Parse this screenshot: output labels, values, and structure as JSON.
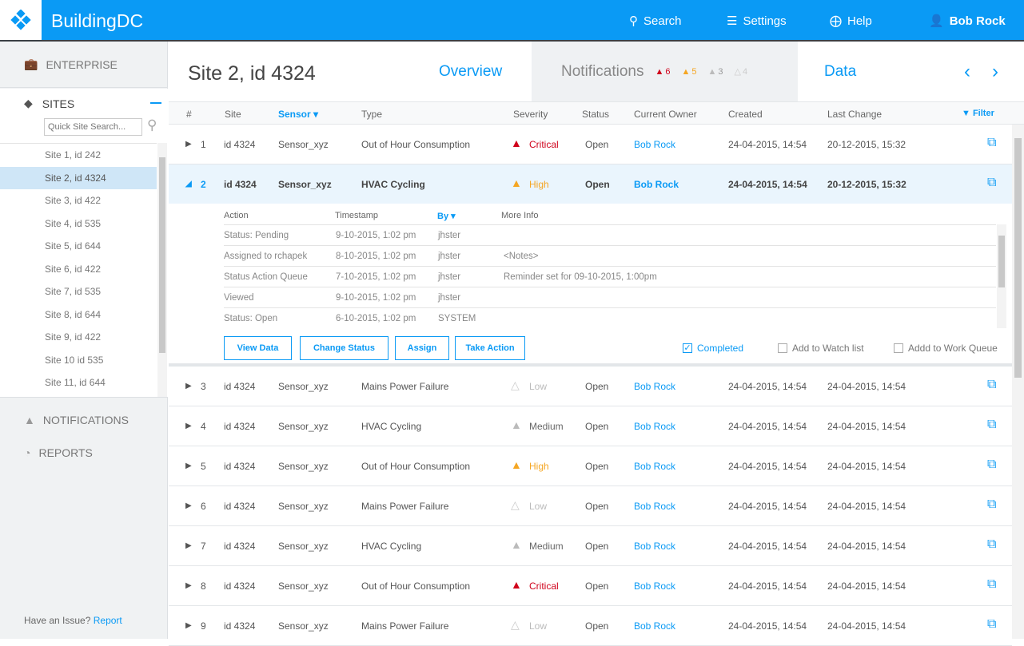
{
  "header": {
    "brand": "BuildingDC",
    "search": "Search",
    "settings": "Settings",
    "help": "Help",
    "user": "Bob Rock"
  },
  "sidebar": {
    "enterprise": "ENTERPRISE",
    "sites": "SITES",
    "search_placeholder": "Quick Site Search...",
    "items": [
      "Site 1, id 242",
      "Site 2, id 4324",
      "Site 3, id 422",
      "Site 4, id 535",
      "Site 5, id 644",
      "Site 6, id 422",
      "Site 7, id 535",
      "Site 8, id 644",
      "Site 9, id 422",
      "Site 10 id 535",
      "Site 11, id 644"
    ],
    "notifications": "NOTIFICATIONS",
    "reports": "REPORTS",
    "issue": "Have an Issue?",
    "report_link": "Report"
  },
  "page": {
    "title": "Site 2, id 4324",
    "tabs": {
      "overview": "Overview",
      "notifications": "Notifications",
      "data": "Data"
    },
    "badges": {
      "critical": "6",
      "high": "5",
      "medium": "3",
      "low": "4"
    }
  },
  "table": {
    "headers": {
      "num": "#",
      "site": "Site",
      "sensor": "Sensor",
      "type": "Type",
      "severity": "Severity",
      "status": "Status",
      "owner": "Current Owner",
      "created": "Created",
      "last": "Last Change",
      "filter": "Filter"
    },
    "rows": [
      {
        "n": "1",
        "site": "id 4324",
        "sensor": "Sensor_xyz",
        "type": "Out of Hour Consumption",
        "sev": "Critical",
        "status": "Open",
        "owner": "Bob Rock",
        "created": "24-04-2015, 14:54",
        "last": "20-12-2015, 15:32"
      },
      {
        "n": "2",
        "site": "id 4324",
        "sensor": "Sensor_xyz",
        "type": "HVAC Cycling",
        "sev": "High",
        "status": "Open",
        "owner": "Bob Rock",
        "created": "24-04-2015, 14:54",
        "last": "20-12-2015, 15:32"
      },
      {
        "n": "3",
        "site": "id 4324",
        "sensor": "Sensor_xyz",
        "type": "Mains Power Failure",
        "sev": "Low",
        "status": "Open",
        "owner": "Bob Rock",
        "created": "24-04-2015, 14:54",
        "last": "24-04-2015, 14:54"
      },
      {
        "n": "4",
        "site": "id 4324",
        "sensor": "Sensor_xyz",
        "type": "HVAC Cycling",
        "sev": "Medium",
        "status": "Open",
        "owner": "Bob Rock",
        "created": "24-04-2015, 14:54",
        "last": "24-04-2015, 14:54"
      },
      {
        "n": "5",
        "site": "id 4324",
        "sensor": "Sensor_xyz",
        "type": "Out of Hour Consumption",
        "sev": "High",
        "status": "Open",
        "owner": "Bob Rock",
        "created": "24-04-2015, 14:54",
        "last": "24-04-2015, 14:54"
      },
      {
        "n": "6",
        "site": "id 4324",
        "sensor": "Sensor_xyz",
        "type": "Mains Power Failure",
        "sev": "Low",
        "status": "Open",
        "owner": "Bob Rock",
        "created": "24-04-2015, 14:54",
        "last": "24-04-2015, 14:54"
      },
      {
        "n": "7",
        "site": "id 4324",
        "sensor": "Sensor_xyz",
        "type": "HVAC Cycling",
        "sev": "Medium",
        "status": "Open",
        "owner": "Bob Rock",
        "created": "24-04-2015, 14:54",
        "last": "24-04-2015, 14:54"
      },
      {
        "n": "8",
        "site": "id 4324",
        "sensor": "Sensor_xyz",
        "type": "Out of Hour Consumption",
        "sev": "Critical",
        "status": "Open",
        "owner": "Bob Rock",
        "created": "24-04-2015, 14:54",
        "last": "24-04-2015, 14:54"
      },
      {
        "n": "9",
        "site": "id 4324",
        "sensor": "Sensor_xyz",
        "type": "Mains Power Failure",
        "sev": "Low",
        "status": "Open",
        "owner": "Bob Rock",
        "created": "24-04-2015, 14:54",
        "last": "24-04-2015, 14:54"
      }
    ]
  },
  "detail": {
    "headers": {
      "action": "Action",
      "timestamp": "Timestamp",
      "by": "By",
      "info": "More Info"
    },
    "rows": [
      {
        "action": "Status: Pending",
        "ts": "9-10-2015, 1:02 pm",
        "by": "jhster",
        "info": ""
      },
      {
        "action": "Assigned to rchapek",
        "ts": "8-10-2015, 1:02 pm",
        "by": "jhster",
        "info": "<Notes>"
      },
      {
        "action": "Status Action Queue",
        "ts": "7-10-2015, 1:02 pm",
        "by": "jhster",
        "info": "Reminder set for 09-10-2015, 1:00pm"
      },
      {
        "action": "Viewed",
        "ts": "9-10-2015, 1:02 pm",
        "by": "jhster",
        "info": ""
      },
      {
        "action": "Status: Open",
        "ts": "6-10-2015, 1:02 pm",
        "by": "SYSTEM",
        "info": ""
      }
    ],
    "buttons": [
      "View Data",
      "Change Status",
      "Assign",
      "Take Action"
    ],
    "checks": {
      "completed": "Completed",
      "watch": "Add to Watch list",
      "queue": "Addd to Work Queue"
    }
  },
  "colors": {
    "accent": "#0a9af5",
    "critical": "#d0021b",
    "high": "#f5a623",
    "medium": "#bbbbbb",
    "low": "#dddddd"
  }
}
